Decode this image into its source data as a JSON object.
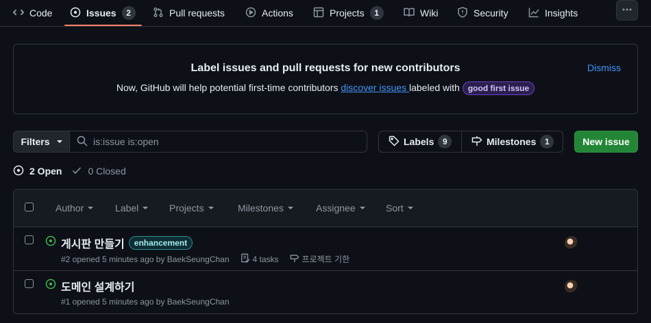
{
  "nav": {
    "code": "Code",
    "issues": "Issues",
    "issues_count": "2",
    "pulls": "Pull requests",
    "actions": "Actions",
    "projects": "Projects",
    "projects_count": "1",
    "wiki": "Wiki",
    "security": "Security",
    "insights": "Insights"
  },
  "banner": {
    "title": "Label issues and pull requests for new contributors",
    "text_before": "Now, GitHub will help potential first-time contributors ",
    "link": "discover issues ",
    "text_after": "labeled with ",
    "label": "good first issue",
    "dismiss": "Dismiss"
  },
  "toolbar": {
    "filters": "Filters",
    "search_value": "is:issue is:open",
    "labels": "Labels",
    "labels_count": "9",
    "milestones": "Milestones",
    "milestones_count": "1",
    "new_issue": "New issue"
  },
  "states": {
    "open": "2 Open",
    "closed": "0 Closed"
  },
  "table_header": {
    "author": "Author",
    "label": "Label",
    "projects": "Projects",
    "milestones": "Milestones",
    "assignee": "Assignee",
    "sort": "Sort"
  },
  "issues": [
    {
      "title": "게시판 만들기",
      "label": "enhancement",
      "meta": "#2 opened 5 minutes ago by BaekSeungChan",
      "tasks": "4 tasks",
      "milestone": "프로젝트 기한"
    },
    {
      "title": "도메인 설계하기",
      "meta": "#1 opened 5 minutes ago by BaekSeungChan"
    }
  ],
  "colors": {
    "accent_underline": "#f78166",
    "open_green": "#3fb950",
    "new_issue_bg": "#238636",
    "link_blue": "#4493f8"
  }
}
